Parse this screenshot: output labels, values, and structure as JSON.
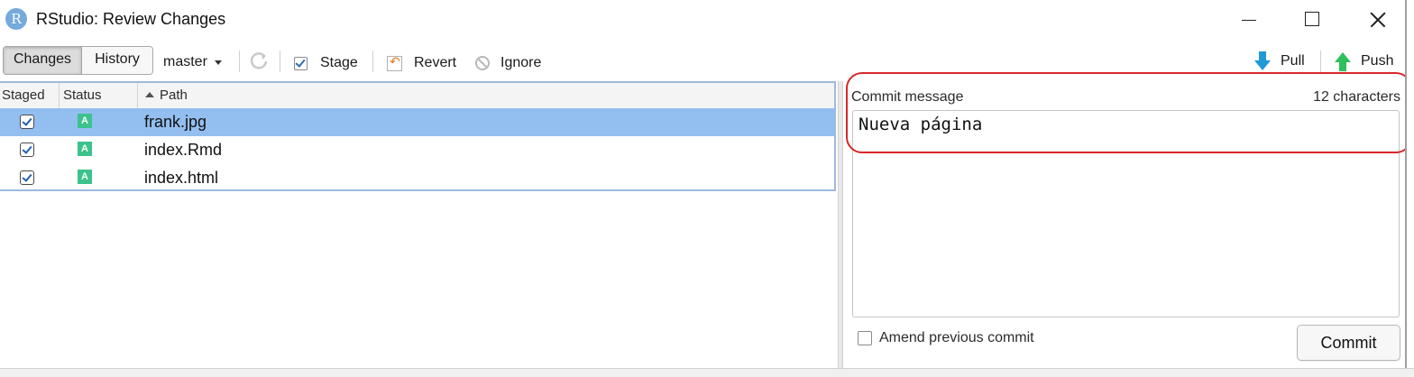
{
  "window": {
    "app_icon_letter": "R",
    "title": "RStudio: Review Changes"
  },
  "toolbar": {
    "tab_changes": "Changes",
    "tab_history": "History",
    "branch": "master",
    "stage_label": "Stage",
    "revert_label": "Revert",
    "ignore_label": "Ignore",
    "pull_label": "Pull",
    "push_label": "Push"
  },
  "table": {
    "columns": [
      "Staged",
      "Status",
      "Path"
    ],
    "rows": [
      {
        "staged": true,
        "status": "A",
        "path": "frank.jpg",
        "selected": true
      },
      {
        "staged": true,
        "status": "A",
        "path": "index.Rmd",
        "selected": false
      },
      {
        "staged": true,
        "status": "A",
        "path": "index.html",
        "selected": false
      }
    ]
  },
  "commit": {
    "label": "Commit message",
    "char_count": "12 characters",
    "message": "Nueva página",
    "amend_label": "Amend previous commit",
    "amend_checked": false,
    "commit_button": "Commit"
  },
  "colors": {
    "selected_row": "#93bff0",
    "status_added": "#3cc28c",
    "highlight_outline": "#d6272a",
    "pull_arrow": "#1e9ad6",
    "push_arrow": "#2fbf5b"
  }
}
